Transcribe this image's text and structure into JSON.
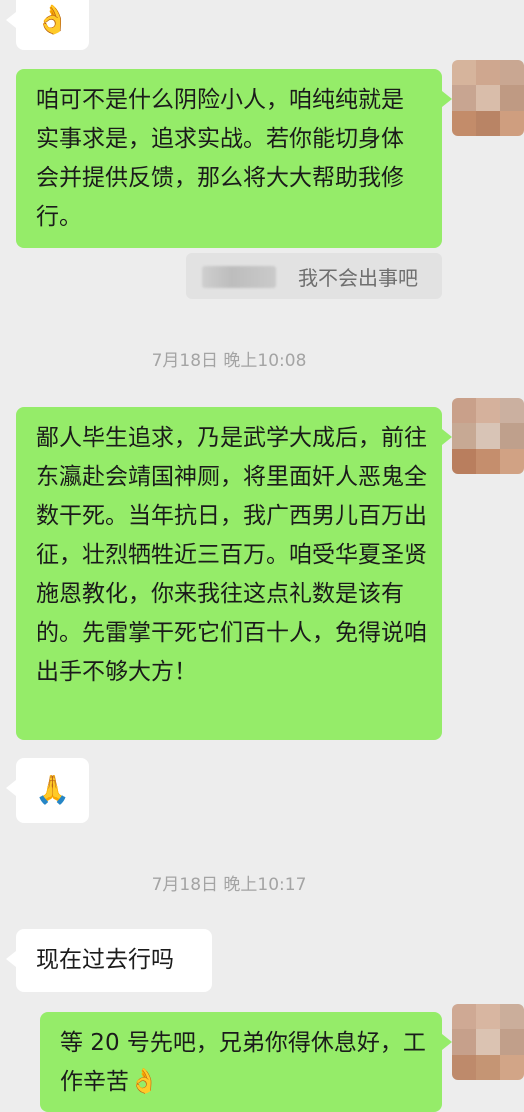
{
  "messages": [
    {
      "id": "m1",
      "side": "them",
      "content": "👌"
    },
    {
      "id": "m2",
      "side": "me",
      "content": "咱可不是什么阴险小人，咱纯纯就是实事求是，追求实战。若你能切身体会并提供反馈，那么将大大帮助我修行。"
    },
    {
      "id": "m3",
      "side": "quote",
      "content": "我不会出事吧"
    },
    {
      "id": "m5",
      "side": "me",
      "content": "鄙人毕生追求，乃是武学大成后，前往东瀛赴会靖国神厕，将里面奸人恶鬼全数干死。当年抗日，我广西男儿百万出征，壮烈牺牲近三百万。咱受华夏圣贤施恩教化，你来我往这点礼数是该有的。先雷掌干死它们百十人，免得说咱出手不够大方！"
    },
    {
      "id": "m6",
      "side": "them",
      "content": "🙏"
    },
    {
      "id": "m8",
      "side": "them",
      "content": "现在过去行吗"
    },
    {
      "id": "m9",
      "side": "me",
      "content": "等 20 号先吧，兄弟你得休息好，工作辛苦"
    }
  ],
  "timestamps": {
    "t1": "7月18日 晚上10:08",
    "t2": "7月18日 晚上10:17"
  },
  "emoji": {
    "ok_hand": "👌",
    "pray": "🙏",
    "ok_hand_inline": "👌"
  },
  "colors": {
    "background": "#ededed",
    "bubble_me": "#95ec69",
    "bubble_them": "#ffffff",
    "timestamp": "#a4a4a4"
  }
}
